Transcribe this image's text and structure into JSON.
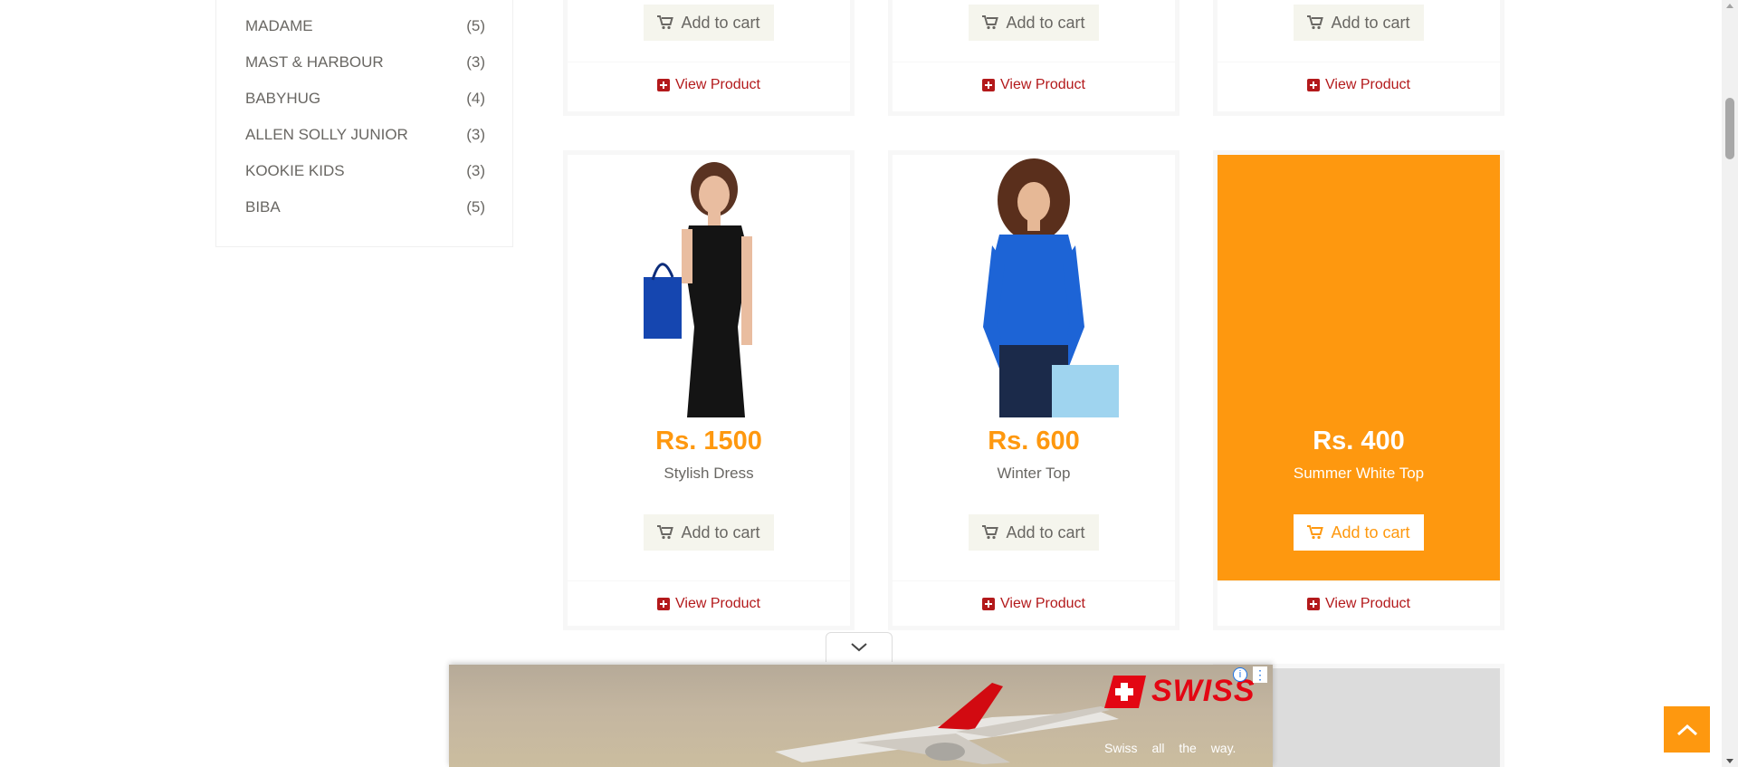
{
  "brands": [
    {
      "name": "MADAME",
      "count": "(5)"
    },
    {
      "name": "MAST & HARBOUR",
      "count": "(3)"
    },
    {
      "name": "BABYHUG",
      "count": "(4)"
    },
    {
      "name": "ALLEN SOLLY JUNIOR",
      "count": "(3)"
    },
    {
      "name": "KOOKIE KIDS",
      "count": "(3)"
    },
    {
      "name": "BIBA",
      "count": "(5)"
    }
  ],
  "top_row": [
    {
      "add_to_cart": "Add to cart",
      "view_product": "View Product"
    },
    {
      "add_to_cart": "Add to cart",
      "view_product": "View Product"
    },
    {
      "add_to_cart": "Add to cart",
      "view_product": "View Product"
    }
  ],
  "products": [
    {
      "price": "Rs. 1500",
      "name": "Stylish Dress",
      "add_to_cart": "Add to cart",
      "view_product": "View Product"
    },
    {
      "price": "Rs. 600",
      "name": "Winter Top",
      "add_to_cart": "Add to cart",
      "view_product": "View Product"
    },
    {
      "price": "Rs. 400",
      "name": "Summer White Top",
      "add_to_cart": "Add to cart",
      "view_product": "View Product"
    }
  ],
  "ad": {
    "brand": "SWISS",
    "slogan": "Swiss all the way.",
    "info_icon": "i",
    "menu_icon": "⋮"
  },
  "colors": {
    "accent": "#fe980f",
    "link_red": "#b3191b",
    "text_gray": "#696763",
    "button_bg": "#f5f5ed"
  },
  "icons": {
    "cart": "shopping-cart-icon",
    "view": "plus-square-icon",
    "scroll_top": "chevron-up-icon",
    "ad_toggle": "chevron-down-icon"
  }
}
